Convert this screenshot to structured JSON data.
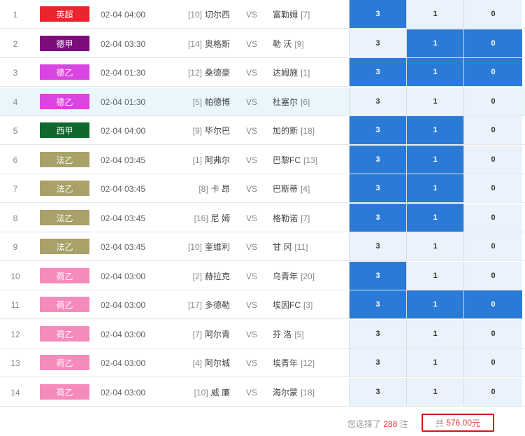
{
  "rows": [
    {
      "num": "1",
      "league": "英超",
      "color": "#e8262d",
      "time": "02-04 04:00",
      "home_rank": "[10]",
      "home": "切尔西",
      "vs": "VS",
      "away": "富勒姆",
      "away_rank": "[7]",
      "odds": [
        "3",
        "1",
        "0"
      ],
      "sel": [
        true,
        false,
        false
      ],
      "hl": false
    },
    {
      "num": "2",
      "league": "德甲",
      "color": "#7d0d7d",
      "time": "02-04 03:30",
      "home_rank": "[14]",
      "home": "奥格斯",
      "vs": "VS",
      "away": "勒 沃",
      "away_rank": "[9]",
      "odds": [
        "3",
        "1",
        "0"
      ],
      "sel": [
        false,
        true,
        true
      ],
      "hl": false
    },
    {
      "num": "3",
      "league": "德乙",
      "color": "#d945e0",
      "time": "02-04 01:30",
      "home_rank": "[12]",
      "home": "桑德豪",
      "vs": "VS",
      "away": "达姆施",
      "away_rank": "[1]",
      "odds": [
        "3",
        "1",
        "0"
      ],
      "sel": [
        true,
        true,
        true
      ],
      "hl": false
    },
    {
      "num": "4",
      "league": "德乙",
      "color": "#d945e0",
      "time": "02-04 01:30",
      "home_rank": "[5]",
      "home": "帕德博",
      "vs": "VS",
      "away": "杜塞尔",
      "away_rank": "[6]",
      "odds": [
        "3",
        "1",
        "0"
      ],
      "sel": [
        false,
        false,
        false
      ],
      "hl": true
    },
    {
      "num": "5",
      "league": "西甲",
      "color": "#11682e",
      "time": "02-04 04:00",
      "home_rank": "[9]",
      "home": "毕尔巴",
      "vs": "VS",
      "away": "加的斯",
      "away_rank": "[18]",
      "odds": [
        "3",
        "1",
        "0"
      ],
      "sel": [
        true,
        true,
        false
      ],
      "hl": false
    },
    {
      "num": "6",
      "league": "法乙",
      "color": "#a8a26a",
      "time": "02-04 03:45",
      "home_rank": "[1]",
      "home": "阿弗尔",
      "vs": "VS",
      "away": "巴黎FC",
      "away_rank": "[13]",
      "odds": [
        "3",
        "1",
        "0"
      ],
      "sel": [
        true,
        true,
        false
      ],
      "hl": false
    },
    {
      "num": "7",
      "league": "法乙",
      "color": "#a8a26a",
      "time": "02-04 03:45",
      "home_rank": "[8]",
      "home": "卡 昂",
      "vs": "VS",
      "away": "巴斯蒂",
      "away_rank": "[4]",
      "odds": [
        "3",
        "1",
        "0"
      ],
      "sel": [
        true,
        true,
        false
      ],
      "hl": false
    },
    {
      "num": "8",
      "league": "法乙",
      "color": "#a8a26a",
      "time": "02-04 03:45",
      "home_rank": "[16]",
      "home": "尼 姆",
      "vs": "VS",
      "away": "格勒诺",
      "away_rank": "[7]",
      "odds": [
        "3",
        "1",
        "0"
      ],
      "sel": [
        true,
        true,
        false
      ],
      "hl": false
    },
    {
      "num": "9",
      "league": "法乙",
      "color": "#a8a26a",
      "time": "02-04 03:45",
      "home_rank": "[10]",
      "home": "奎维利",
      "vs": "VS",
      "away": "甘 冈",
      "away_rank": "[11]",
      "odds": [
        "3",
        "1",
        "0"
      ],
      "sel": [
        false,
        false,
        false
      ],
      "hl": false
    },
    {
      "num": "10",
      "league": "荷乙",
      "color": "#f58bbd",
      "time": "02-04 03:00",
      "home_rank": "[2]",
      "home": "赫拉克",
      "vs": "VS",
      "away": "乌青年",
      "away_rank": "[20]",
      "odds": [
        "3",
        "1",
        "0"
      ],
      "sel": [
        true,
        false,
        false
      ],
      "hl": false
    },
    {
      "num": "11",
      "league": "荷乙",
      "color": "#f58bbd",
      "time": "02-04 03:00",
      "home_rank": "[17]",
      "home": "多德勒",
      "vs": "VS",
      "away": "埃因FC",
      "away_rank": "[3]",
      "odds": [
        "3",
        "1",
        "0"
      ],
      "sel": [
        true,
        true,
        true
      ],
      "hl": false
    },
    {
      "num": "12",
      "league": "荷乙",
      "color": "#f58bbd",
      "time": "02-04 03:00",
      "home_rank": "[7]",
      "home": "阿尔青",
      "vs": "VS",
      "away": "芬 洛",
      "away_rank": "[5]",
      "odds": [
        "3",
        "1",
        "0"
      ],
      "sel": [
        false,
        false,
        false
      ],
      "hl": false
    },
    {
      "num": "13",
      "league": "荷乙",
      "color": "#f58bbd",
      "time": "02-04 03:00",
      "home_rank": "[4]",
      "home": "阿尔城",
      "vs": "VS",
      "away": "埃青年",
      "away_rank": "[12]",
      "odds": [
        "3",
        "1",
        "0"
      ],
      "sel": [
        false,
        false,
        false
      ],
      "hl": false
    },
    {
      "num": "14",
      "league": "荷乙",
      "color": "#f58bbd",
      "time": "02-04 03:00",
      "home_rank": "[10]",
      "home": "威 廉",
      "vs": "VS",
      "away": "海尔蒙",
      "away_rank": "[18]",
      "odds": [
        "3",
        "1",
        "0"
      ],
      "sel": [
        false,
        false,
        false
      ],
      "hl": false
    }
  ],
  "footer": {
    "selected_prefix": "您选择了",
    "selected_count": "288",
    "selected_suffix": "注",
    "total_prefix": "共",
    "total_amount": "576.00",
    "total_suffix": "元"
  },
  "colors": {
    "selected": "#2b7ad6",
    "unselected": "#eaf3fb",
    "highlight_row": "#e9f6fc",
    "total_border": "#e01010",
    "accent_red": "#e53a3a"
  }
}
